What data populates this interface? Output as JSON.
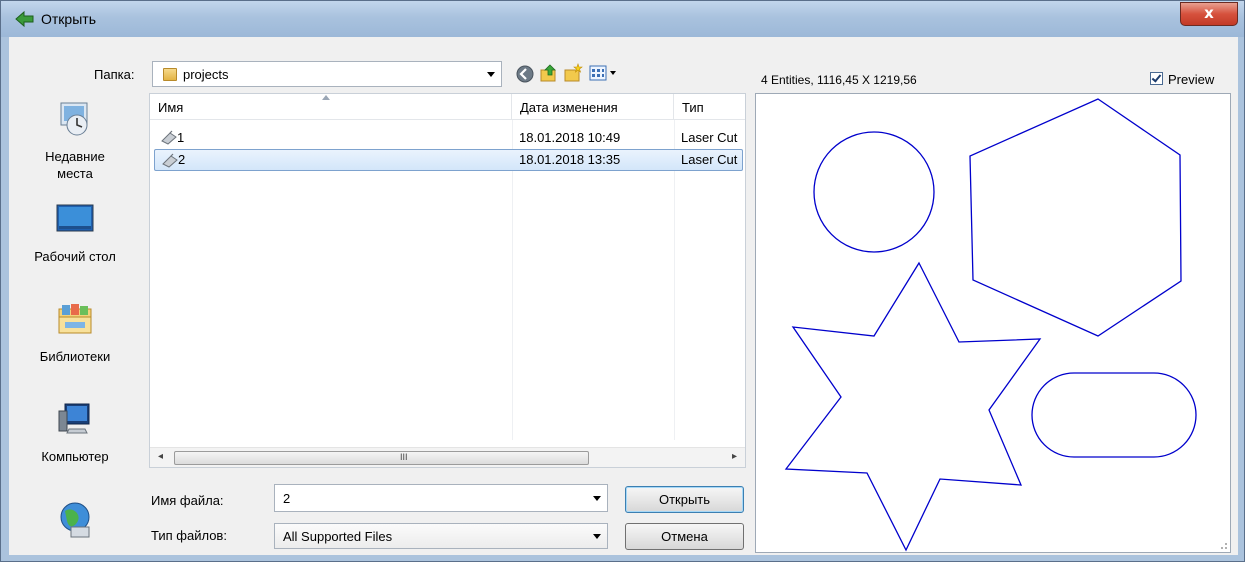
{
  "window": {
    "title": "Открыть",
    "close_label": "x"
  },
  "lookin": {
    "label": "Папка:",
    "value": "projects"
  },
  "places": [
    {
      "label": "Недавние\nместа",
      "icon": "recent-places-icon"
    },
    {
      "label": "Рабочий стол",
      "icon": "desktop-icon"
    },
    {
      "label": "Библиотеки",
      "icon": "libraries-icon"
    },
    {
      "label": "Компьютер",
      "icon": "computer-icon"
    },
    {
      "label": "",
      "icon": "network-icon"
    }
  ],
  "filelist": {
    "columns": [
      "Имя",
      "Дата изменения",
      "Тип"
    ],
    "rows": [
      {
        "name": "1",
        "date": "18.01.2018 10:49",
        "type": "Laser Cut"
      },
      {
        "name": "2",
        "date": "18.01.2018 13:35",
        "type": "Laser Cut",
        "selected": true
      }
    ],
    "scroll_grip": "III"
  },
  "filename": {
    "label": "Имя файла:",
    "value": "2"
  },
  "filetype": {
    "label": "Тип файлов:",
    "value": "All Supported Files"
  },
  "buttons": {
    "open": "Открыть",
    "cancel": "Отмена"
  },
  "preview": {
    "info": "4 Entities, 1116,45 X 1219,56",
    "checkbox_label": "Preview",
    "checked": true,
    "stroke_color": "#0000cc"
  },
  "colors": {
    "title_bar": "#abc3dd",
    "close": "#c9402b",
    "selection": "#d3e6fa"
  }
}
